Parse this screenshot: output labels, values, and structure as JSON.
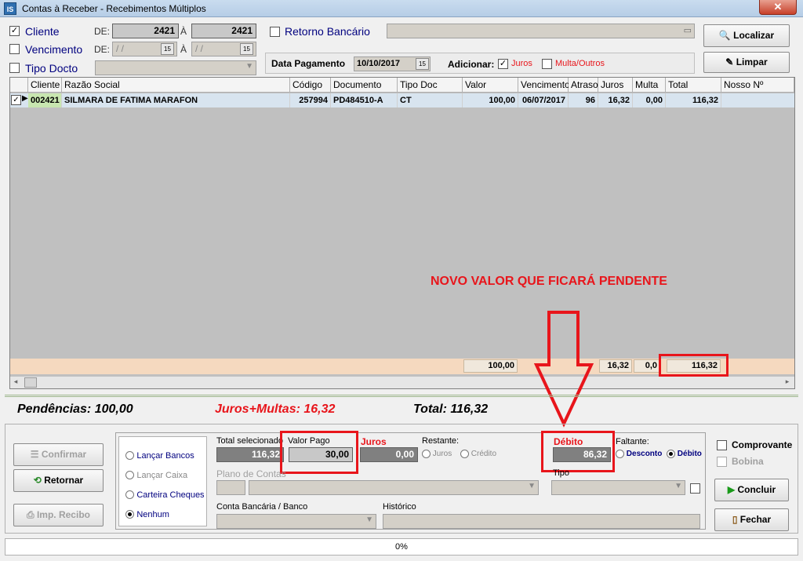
{
  "window": {
    "title": "Contas à Receber - Recebimentos Múltiplos",
    "icon_text": "IS",
    "close_label": "✕"
  },
  "filters": {
    "cliente_label": "Cliente",
    "cliente_checked": true,
    "cliente_de_label": "DE:",
    "cliente_de": "2421",
    "cliente_a_label": "À",
    "cliente_a": "2421",
    "vencimento_label": "Vencimento",
    "vencimento_de_label": "DE:",
    "vencimento_de": "/ /",
    "vencimento_a_label": "À",
    "vencimento_a": "/ /",
    "tipo_label": "Tipo Docto",
    "retorno_label": "Retorno Bancário",
    "data_pagamento_label": "Data Pagamento",
    "data_pagamento": "10/10/2017",
    "adicionar_label": "Adicionar:",
    "juros_label": "Juros",
    "multa_label": "Multa/Outros",
    "calendar_icon_text": "15"
  },
  "actions": {
    "localizar": "Localizar",
    "limpar": "Limpar"
  },
  "grid": {
    "headers": [
      "Cliente",
      "Razão Social",
      "Código",
      "Documento",
      "Tipo Doc",
      "Valor",
      "Vencimento",
      "Atraso",
      "Juros",
      "Multa",
      "Total",
      "Nosso Nº"
    ],
    "row": {
      "cliente": "002421",
      "razao": "SILMARA DE FATIMA MARAFON",
      "codigo": "257994",
      "documento": "PD484510-A",
      "tipo": "CT",
      "valor": "100,00",
      "vencimento": "06/07/2017",
      "atraso": "96",
      "juros": "16,32",
      "multa": "0,00",
      "total": "116,32"
    },
    "footer": {
      "valor": "100,00",
      "juros": "16,32",
      "multa": "0,0",
      "total": "116,32"
    }
  },
  "annotation": {
    "text": "NOVO VALOR QUE FICARÁ PENDENTE"
  },
  "summary": {
    "pendencias": "Pendências: 100,00",
    "juros_multas": "Juros+Multas: 16,32",
    "total": "Total: 116,32"
  },
  "payment": {
    "lancar_bancos": "Lançar Bancos",
    "lancar_caixa": "Lançar Caixa",
    "carteira_cheques": "Carteira Cheques",
    "nenhum": "Nenhum",
    "total_sel_label": "Total selecionado",
    "total_sel": "116,32",
    "valor_pago_label": "Valor Pago",
    "valor_pago": "30,00",
    "juros_label": "Juros",
    "juros": "0,00",
    "restante_label": "Restante:",
    "rest_juros": "Juros",
    "rest_credito": "Crédito",
    "debito_label": "Débito",
    "debito": "86,32",
    "faltante_label": "Faltante:",
    "falt_desconto": "Desconto",
    "falt_debito": "Débito",
    "plano_label": "Plano de Contas",
    "tipo_label": "Tipo",
    "conta_label": "Conta Bancária / Banco",
    "historico_label": "Histórico"
  },
  "buttons": {
    "confirmar": "Confirmar",
    "retornar": "Retornar",
    "imp_recibo": "Imp. Recibo",
    "concluir": "Concluir",
    "fechar": "Fechar"
  },
  "options": {
    "comprovante": "Comprovante",
    "bobina": "Bobina"
  },
  "status": {
    "progress": "0%"
  },
  "colors": {
    "accent_red": "#e8151b",
    "label_blue": "#00007f"
  }
}
